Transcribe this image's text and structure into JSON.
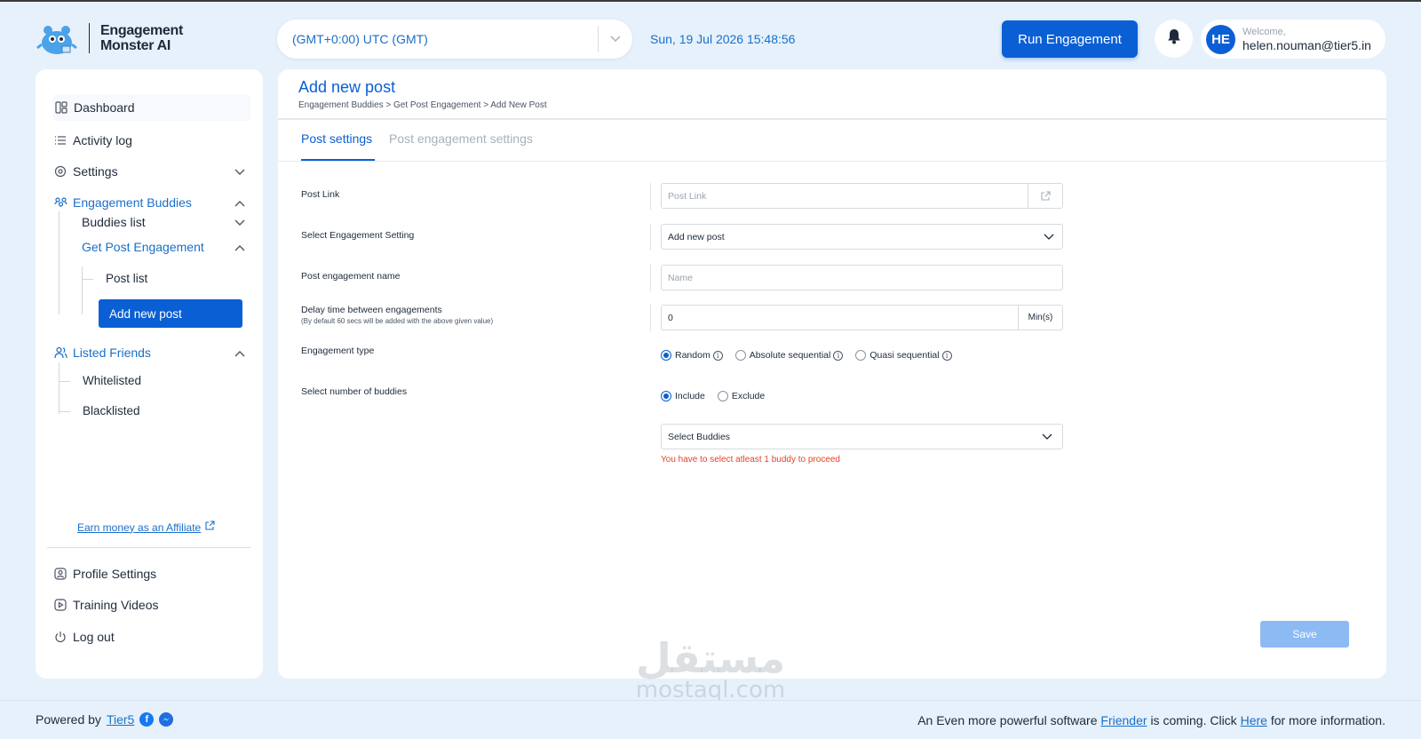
{
  "header": {
    "logo_line1": "Engagement",
    "logo_line2": "Monster AI",
    "timezone": "(GMT+0:00) UTC (GMT)",
    "datetime": "Sun, 19 Jul 2026 15:48:56",
    "run_button": "Run Engagement",
    "user": {
      "initials": "HE",
      "welcome": "Welcome,",
      "email": "helen.nouman@tier5.in"
    }
  },
  "sidebar": {
    "dashboard": "Dashboard",
    "activity_log": "Activity log",
    "settings": "Settings",
    "engagement_buddies": "Engagement Buddies",
    "buddies_list": "Buddies list",
    "get_post_engagement": "Get Post Engagement",
    "post_list": "Post list",
    "add_new_post": "Add new post",
    "listed_friends": "Listed Friends",
    "whitelisted": "Whitelisted",
    "blacklisted": "Blacklisted",
    "affiliate": "Earn money as an Affiliate",
    "profile_settings": "Profile Settings",
    "training_videos": "Training Videos",
    "log_out": "Log out"
  },
  "main": {
    "title": "Add new post",
    "breadcrumb": "Engagement Buddies > Get Post Engagement > Add New Post",
    "tabs": [
      {
        "label": "Post settings",
        "active": true
      },
      {
        "label": "Post engagement settings",
        "active": false
      }
    ],
    "form": {
      "post_link_label": "Post Link",
      "post_link_placeholder": "Post Link",
      "engagement_setting_label": "Select Engagement Setting",
      "engagement_setting_value": "Add new post",
      "name_label": "Post engagement name",
      "name_placeholder": "Name",
      "delay_label": "Delay time between engagements",
      "delay_note": "(By default 60 secs will be added with the above given value)",
      "delay_value": "0",
      "delay_unit": "Min(s)",
      "engagement_type_label": "Engagement type",
      "engagement_types": [
        "Random",
        "Absolute sequential",
        "Quasi sequential"
      ],
      "engagement_type_selected": "Random",
      "buddies_label": "Select number of buddies",
      "buddy_modes": [
        "Include",
        "Exclude"
      ],
      "buddy_mode_selected": "Include",
      "buddies_select": "Select Buddies",
      "error": "You have to select atleast 1 buddy to proceed"
    },
    "save_button": "Save"
  },
  "footer": {
    "powered_by": "Powered by",
    "tier5": "Tier5",
    "notice_part1": "An Even more powerful software",
    "friender": "Friender",
    "notice_part2": "is coming. Click",
    "here": "Here",
    "notice_part3": "for more information."
  },
  "watermark": {
    "arabic": "مستقل",
    "latin": "mostaql.com"
  },
  "colors": {
    "primary": "#0b5fd4",
    "link": "#1a6fc9",
    "background": "#e6f1fb",
    "error": "#e0452b",
    "save_disabled": "#8cbaf2"
  }
}
